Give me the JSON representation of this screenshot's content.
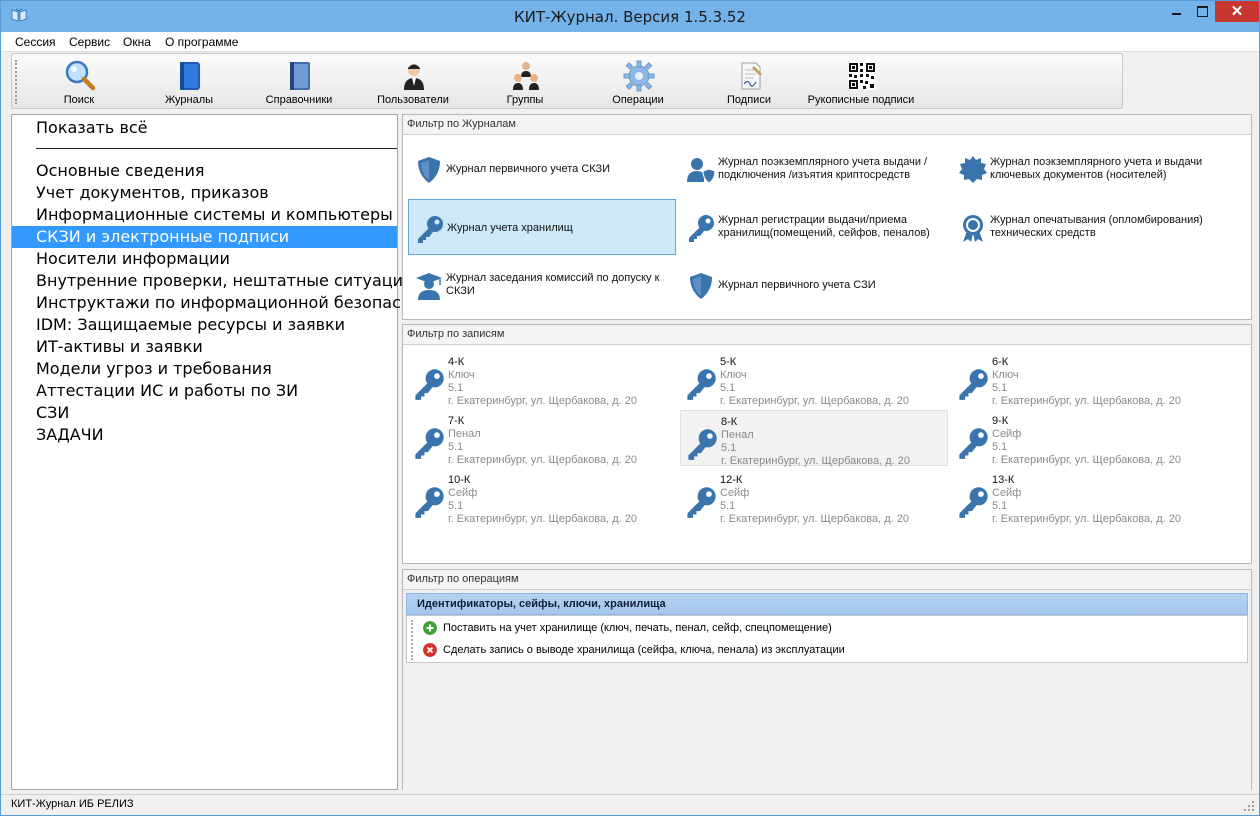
{
  "window": {
    "title": "КИТ-Журнал. Версия 1.5.3.52",
    "close_glyph": "✕"
  },
  "menu": [
    "Сессия",
    "Сервис",
    "Окна",
    "О программе"
  ],
  "toolbar": [
    {
      "label": "Поиск",
      "icon": "magnifier-icon"
    },
    {
      "label": "Журналы",
      "icon": "blue-book-icon"
    },
    {
      "label": "Справочники",
      "icon": "notebook-icon"
    },
    {
      "label": "Пользователи",
      "icon": "user-icon"
    },
    {
      "label": "Группы",
      "icon": "group-icon"
    },
    {
      "label": "Операции",
      "icon": "gear-icon"
    },
    {
      "label": "Подписи",
      "icon": "signature-doc-icon"
    },
    {
      "label": "Рукописные подписи",
      "icon": "qr-code-icon"
    }
  ],
  "sidebar": {
    "show_all": "Показать всё",
    "items": [
      "Основные сведения",
      "Учет документов, приказов",
      "Информационные системы и компьютеры",
      "СКЗИ и электронные подписи",
      "Носители информации",
      "Внутренние проверки, нештатные ситуации",
      "Инструктажи по информационной безопасности",
      "IDM: Защищаемые ресурсы  и заявки",
      "ИТ-активы и заявки",
      "Модели угроз и требования",
      "Аттестации ИС и работы по ЗИ",
      "СЗИ",
      "ЗАДАЧИ"
    ],
    "active_index": 3
  },
  "journals_filter": {
    "header": "Фильтр по Журналам",
    "items": [
      {
        "text": "Журнал первичного учета СКЗИ",
        "icon": "shield-icon"
      },
      {
        "text": "Журнал поэкземплярного учета выдачи /подключения /изъятия криптосредств",
        "icon": "user-shield-icon"
      },
      {
        "text": "Журнал поэкземплярного учета и выдачи ключевых документов (носителей)",
        "icon": "seal-badge-icon"
      },
      {
        "text": "Журнал учета хранилищ",
        "icon": "key-icon",
        "selected": true
      },
      {
        "text": "Журнал регистрации выдачи/приема хранилищ(помещений, сейфов, пеналов)",
        "icon": "key-icon"
      },
      {
        "text": "Журнал опечатывания (опломбирования) технических средств",
        "icon": "award-icon"
      },
      {
        "text": "Журнал заседания комиссий по допуску к СКЗИ",
        "icon": "graduate-icon"
      },
      {
        "text": "Журнал первичного учета СЗИ",
        "icon": "shield-icon"
      }
    ]
  },
  "records_filter": {
    "header": "Фильтр по записям",
    "items": [
      {
        "num": "4-К",
        "type": "Ключ",
        "ver": "5.1",
        "addr": "г. Екатеринбург, ул. Щербакова, д. 20"
      },
      {
        "num": "5-К",
        "type": "Ключ",
        "ver": "5.1",
        "addr": "г. Екатеринбург, ул. Щербакова, д. 20"
      },
      {
        "num": "6-К",
        "type": "Ключ",
        "ver": "5.1",
        "addr": "г. Екатеринбург, ул. Щербакова, д. 20"
      },
      {
        "num": "7-К",
        "type": "Пенал",
        "ver": "5.1",
        "addr": "г. Екатеринбург, ул. Щербакова, д. 20"
      },
      {
        "num": "8-К",
        "type": "Пенал",
        "ver": "5.1",
        "addr": "г. Екатеринбург, ул. Щербакова, д. 20",
        "hover": true
      },
      {
        "num": "9-К",
        "type": "Сейф",
        "ver": "5.1",
        "addr": "г. Екатеринбург, ул. Щербакова, д. 20"
      },
      {
        "num": "10-К",
        "type": "Сейф",
        "ver": "5.1",
        "addr": "г. Екатеринбург, ул. Щербакова, д. 20"
      },
      {
        "num": "12-К",
        "type": "Сейф",
        "ver": "5.1",
        "addr": "г. Екатеринбург, ул. Щербакова, д. 20"
      },
      {
        "num": "13-К",
        "type": "Сейф",
        "ver": "5.1",
        "addr": "г. Екатеринбург, ул. Щербакова, д. 20"
      }
    ]
  },
  "operations_filter": {
    "header": "Фильтр по операциям",
    "category": "Идентификаторы, сейфы, ключи, хранилища",
    "items": [
      {
        "text": "Поставить на учет хранилище (ключ, печать, пенал, сейф, спецпомещение)",
        "icon": "add-circle-icon",
        "color": "#3da336"
      },
      {
        "text": "Сделать запись о выводе хранилища (сейфа, ключа, пенала) из эксплуатации",
        "icon": "remove-circle-icon",
        "color": "#d8312b"
      }
    ]
  },
  "statusbar": {
    "text": "КИТ-Журнал ИБ РЕЛИЗ"
  },
  "colors": {
    "accent": "#3399ff",
    "icon_blue": "#3a74ad",
    "icon_grey": "#8a9bb0"
  }
}
